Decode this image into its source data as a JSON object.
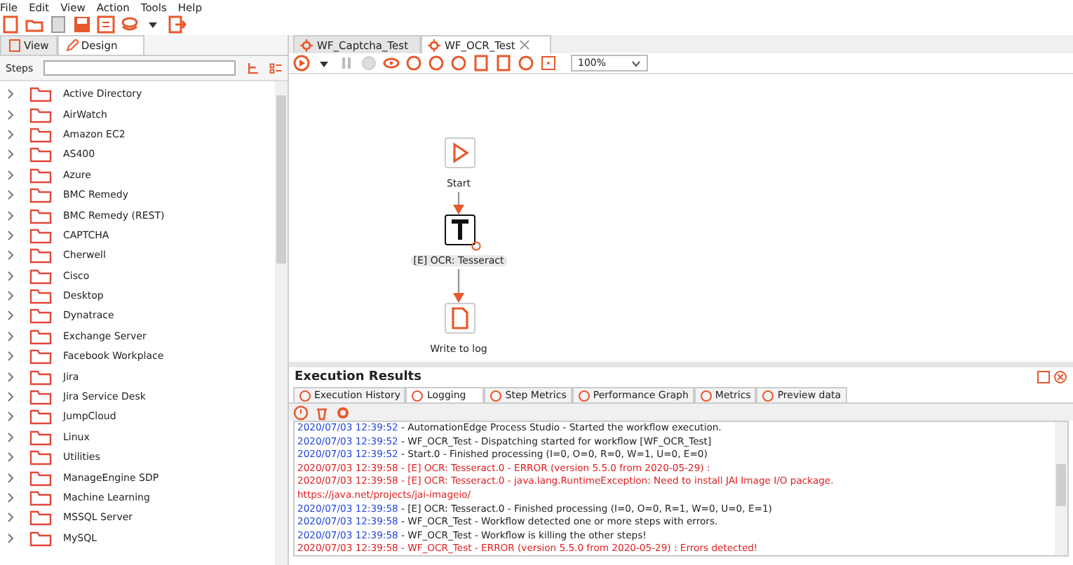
{
  "menu": [
    "File",
    "Edit",
    "View",
    "Action",
    "Tools",
    "Help"
  ],
  "left_tabs": [
    {
      "label": "View",
      "selected": false
    },
    {
      "label": "Design",
      "selected": true
    }
  ],
  "steps_search": {
    "label": "Steps"
  },
  "tree": [
    {
      "label": "Active Directory"
    },
    {
      "label": "AirWatch"
    },
    {
      "label": "Amazon EC2"
    },
    {
      "label": "AS400"
    },
    {
      "label": "Azure"
    },
    {
      "label": "BMC Remedy"
    },
    {
      "label": "BMC Remedy (REST)"
    },
    {
      "label": "CAPTCHA"
    },
    {
      "label": "Cherwell"
    },
    {
      "label": "Cisco"
    },
    {
      "label": "Desktop"
    },
    {
      "label": "Dynatrace"
    },
    {
      "label": "Exchange Server"
    },
    {
      "label": "Facebook Workplace"
    },
    {
      "label": "Jira"
    },
    {
      "label": "Jira Service Desk"
    },
    {
      "label": "JumpCloud"
    },
    {
      "label": "Linux"
    },
    {
      "label": "Utilities"
    },
    {
      "label": "ManageEngine SDP"
    },
    {
      "label": "Machine Learning"
    },
    {
      "label": "MSSQL Server"
    },
    {
      "label": "MySQL"
    }
  ],
  "editor_tabs": [
    {
      "label": "WF_Captcha_Test",
      "selected": false
    },
    {
      "label": "WF_OCR_Test",
      "selected": true
    }
  ],
  "zoom": "100%",
  "nodes": [
    {
      "kind": "start",
      "label": "Start"
    },
    {
      "kind": "text",
      "label": "[E] OCR: Tesseract",
      "error": true
    },
    {
      "kind": "log",
      "label": "Write to log"
    }
  ],
  "results": {
    "title": "Execution Results",
    "tabs": [
      {
        "label": "Execution History",
        "selected": false
      },
      {
        "label": "Logging",
        "selected": true
      },
      {
        "label": "Step Metrics",
        "selected": false
      },
      {
        "label": "Performance Graph",
        "selected": false
      },
      {
        "label": "Metrics",
        "selected": false
      },
      {
        "label": "Preview data",
        "selected": false
      }
    ],
    "log": [
      {
        "kind": "info",
        "time": "2020/07/03 12:39:52",
        "message": " - AutomationEdge Process Studio - Started the workflow execution."
      },
      {
        "kind": "info",
        "time": "2020/07/03 12:39:52",
        "message": " - WF_OCR_Test - Dispatching started for workflow [WF_OCR_Test]"
      },
      {
        "kind": "info",
        "time": "2020/07/03 12:39:52",
        "message": " - Start.0 - Finished processing (I=0, O=0, R=0, W=1, U=0, E=0)"
      },
      {
        "kind": "error",
        "time": "2020/07/03 12:39:58",
        "message": " - [E] OCR: Tesseract.0 - ERROR (version 5.5.0 from 2020-05-29) :"
      },
      {
        "kind": "error",
        "time": "2020/07/03 12:39:58",
        "message": " - [E] OCR: Tesseract.0 - java.lang.RuntimeException: Need to install JAI Image I/O package."
      },
      {
        "kind": "error",
        "message": "https://java.net/projects/jai-imageio/"
      },
      {
        "kind": "info",
        "time": "2020/07/03 12:39:58",
        "message": " - [E] OCR: Tesseract.0 - Finished processing (I=0, O=0, R=1, W=0, U=0, E=1)"
      },
      {
        "kind": "info",
        "time": "2020/07/03 12:39:58",
        "message": " - WF_OCR_Test - Workflow detected one or more steps with errors."
      },
      {
        "kind": "info",
        "time": "2020/07/03 12:39:58",
        "message": " - WF_OCR_Test - Workflow is killing the other steps!"
      },
      {
        "kind": "error",
        "time": "2020/07/03 12:39:58",
        "message": " - WF_OCR_Test - ERROR (version 5.5.0 from 2020-05-29) : Errors detected!"
      }
    ]
  }
}
